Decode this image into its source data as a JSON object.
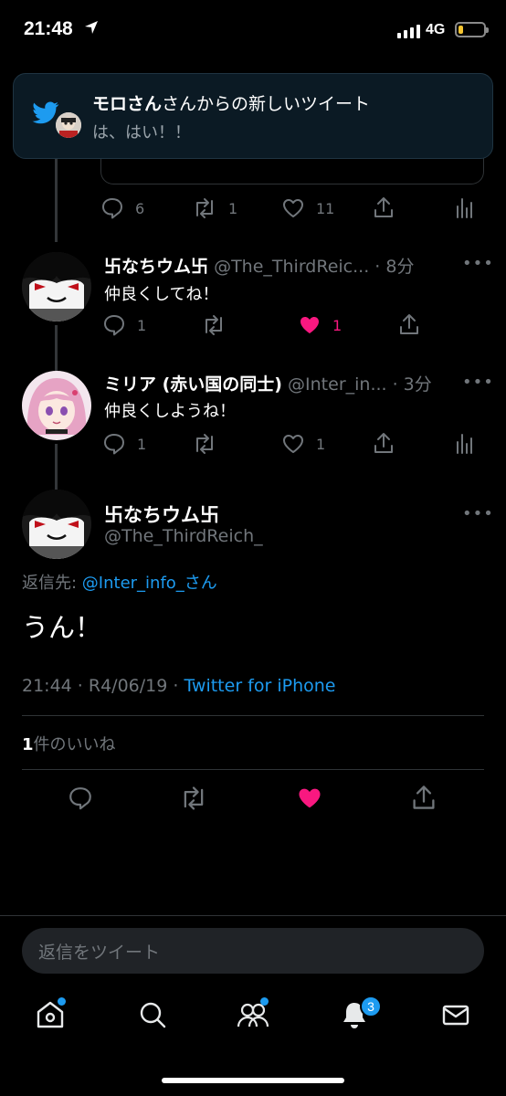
{
  "status_bar": {
    "time": "21:48",
    "network": "4G"
  },
  "notification": {
    "sender": "モロさん",
    "title_suffix": "さんからの新しいツイート",
    "body": "は、はい！！"
  },
  "quoted_tweet_actions": {
    "reply_count": "6",
    "retweet_count": "1",
    "like_count": "11"
  },
  "replies": [
    {
      "name": "卐なちウム卐",
      "handle_time": "@The_ThirdReic... · 8分",
      "text": "仲良くしてね！",
      "reply_count": "1",
      "retweet_count": "",
      "like_count": "1",
      "liked": true
    },
    {
      "name": "ミリア (赤い国の同士)",
      "handle_time": "@Inter_in... · 3分",
      "text": "仲良くしようね！",
      "reply_count": "1",
      "retweet_count": "",
      "like_count": "1",
      "liked": false
    }
  ],
  "main_tweet": {
    "name": "卐なちウム卐",
    "handle": "@The_ThirdReich_",
    "reply_to_prefix": "返信先: ",
    "reply_to_user": "@Inter_info_さん",
    "text": "うん！",
    "timestamp": "21:44 · R4/06/19 · ",
    "source": "Twitter for iPhone",
    "likes_count": "1",
    "likes_label": "件のいいね"
  },
  "reply_input": {
    "placeholder": "返信をツイート"
  },
  "tab_bar": {
    "notifications_badge": "3"
  },
  "colors": {
    "accent": "#1d9bf0",
    "like": "#f91880",
    "background": "#000000"
  }
}
